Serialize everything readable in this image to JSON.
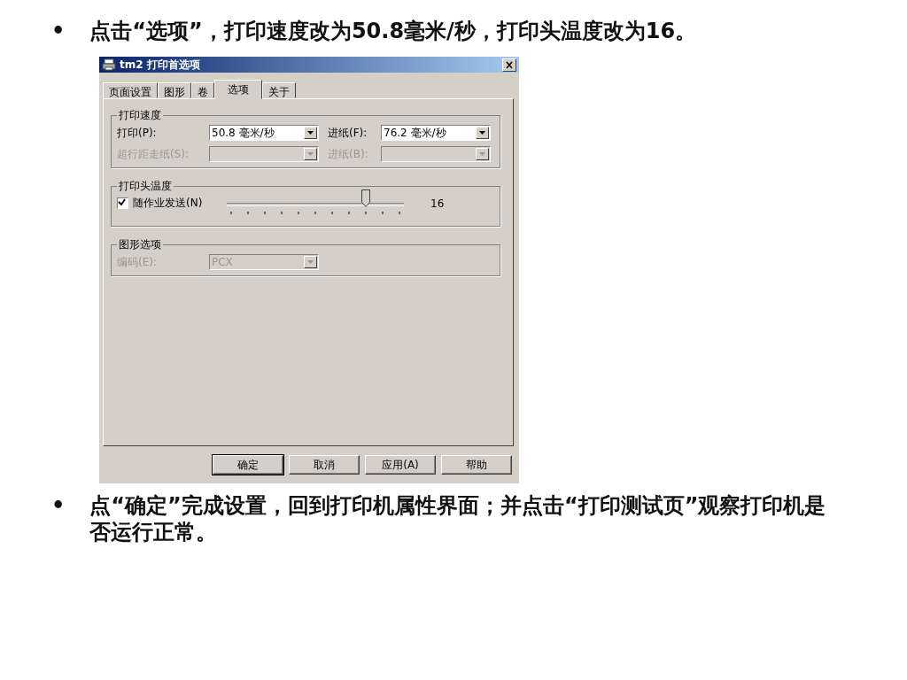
{
  "bullet_1": {
    "bullet": "•",
    "text": "点击“选项”，打印速度改为50.8毫米/秒，打印头温度改为16。"
  },
  "dialog": {
    "title": "tm2 打印首选项",
    "tabs": [
      {
        "label": "页面设置",
        "selected": false
      },
      {
        "label": "图形",
        "selected": false
      },
      {
        "label": "卷",
        "selected": false
      },
      {
        "label": "选项",
        "selected": true
      },
      {
        "label": "关于",
        "selected": false
      }
    ],
    "groups": [
      {
        "kind": "combos",
        "title": "打印速度",
        "rows": [
          [
            {
              "label": "打印(P):",
              "value": "50.8 毫米/秒",
              "disabled": false
            },
            {
              "label": "进纸(F):",
              "value": "76.2 毫米/秒",
              "disabled": false
            }
          ],
          [
            {
              "label": "超行距走纸(S):",
              "disabled": true
            },
            {
              "label": "进纸(B):",
              "disabled": true
            }
          ]
        ]
      },
      {
        "kind": "slider",
        "title": "打印头温度",
        "checkbox": {
          "label": "随作业发送(N)",
          "checked": true
        },
        "level": 0.8,
        "reading": "16"
      },
      {
        "kind": "combos",
        "title": "图形选项",
        "rows": [
          [
            {
              "label": "编码(E):",
              "value": "PCX",
              "disabled": true
            }
          ]
        ]
      }
    ],
    "buttons": [
      {
        "label": "确定",
        "default": true
      },
      {
        "label": "取消",
        "default": false
      },
      {
        "label": "应用(A)",
        "default": false
      },
      {
        "label": "帮助",
        "default": false
      }
    ]
  },
  "bullet_2": {
    "bullet": "•",
    "text": "点“确定”完成设置，回到打印机属性界面；并点击“打印测试页”观察打印机是否运行正常。"
  }
}
